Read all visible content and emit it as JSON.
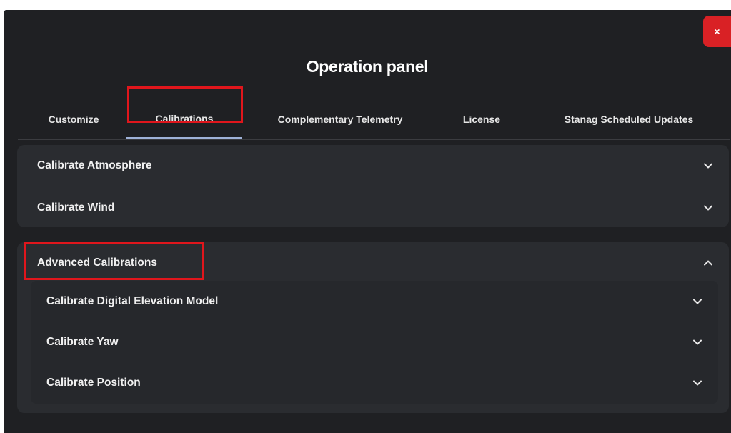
{
  "dialog": {
    "title": "Operation panel",
    "close_label": "×"
  },
  "tabs": [
    {
      "label": "Customize",
      "active": false
    },
    {
      "label": "Calibrations",
      "active": true
    },
    {
      "label": "Complementary Telemetry",
      "active": false
    },
    {
      "label": "License",
      "active": false
    },
    {
      "label": "Stanag Scheduled Updates",
      "active": false
    }
  ],
  "sections": {
    "atmosphere": {
      "label": "Calibrate Atmosphere",
      "expanded": false,
      "icon": "chevron-down-icon"
    },
    "wind": {
      "label": "Calibrate Wind",
      "expanded": false,
      "icon": "chevron-down-icon"
    },
    "advanced": {
      "label": "Advanced Calibrations",
      "expanded": true,
      "icon": "chevron-up-icon",
      "items": [
        {
          "label": "Calibrate Digital Elevation Model",
          "icon": "chevron-down-icon"
        },
        {
          "label": "Calibrate Yaw",
          "icon": "chevron-down-icon"
        },
        {
          "label": "Calibrate Position",
          "icon": "chevron-down-icon"
        }
      ]
    }
  },
  "colors": {
    "panel_bg": "#1f2023",
    "section_bg": "#2a2c30",
    "close_button": "#d92125",
    "highlight_box": "#e0161c",
    "active_tab_underline": "#9fb2d8"
  }
}
